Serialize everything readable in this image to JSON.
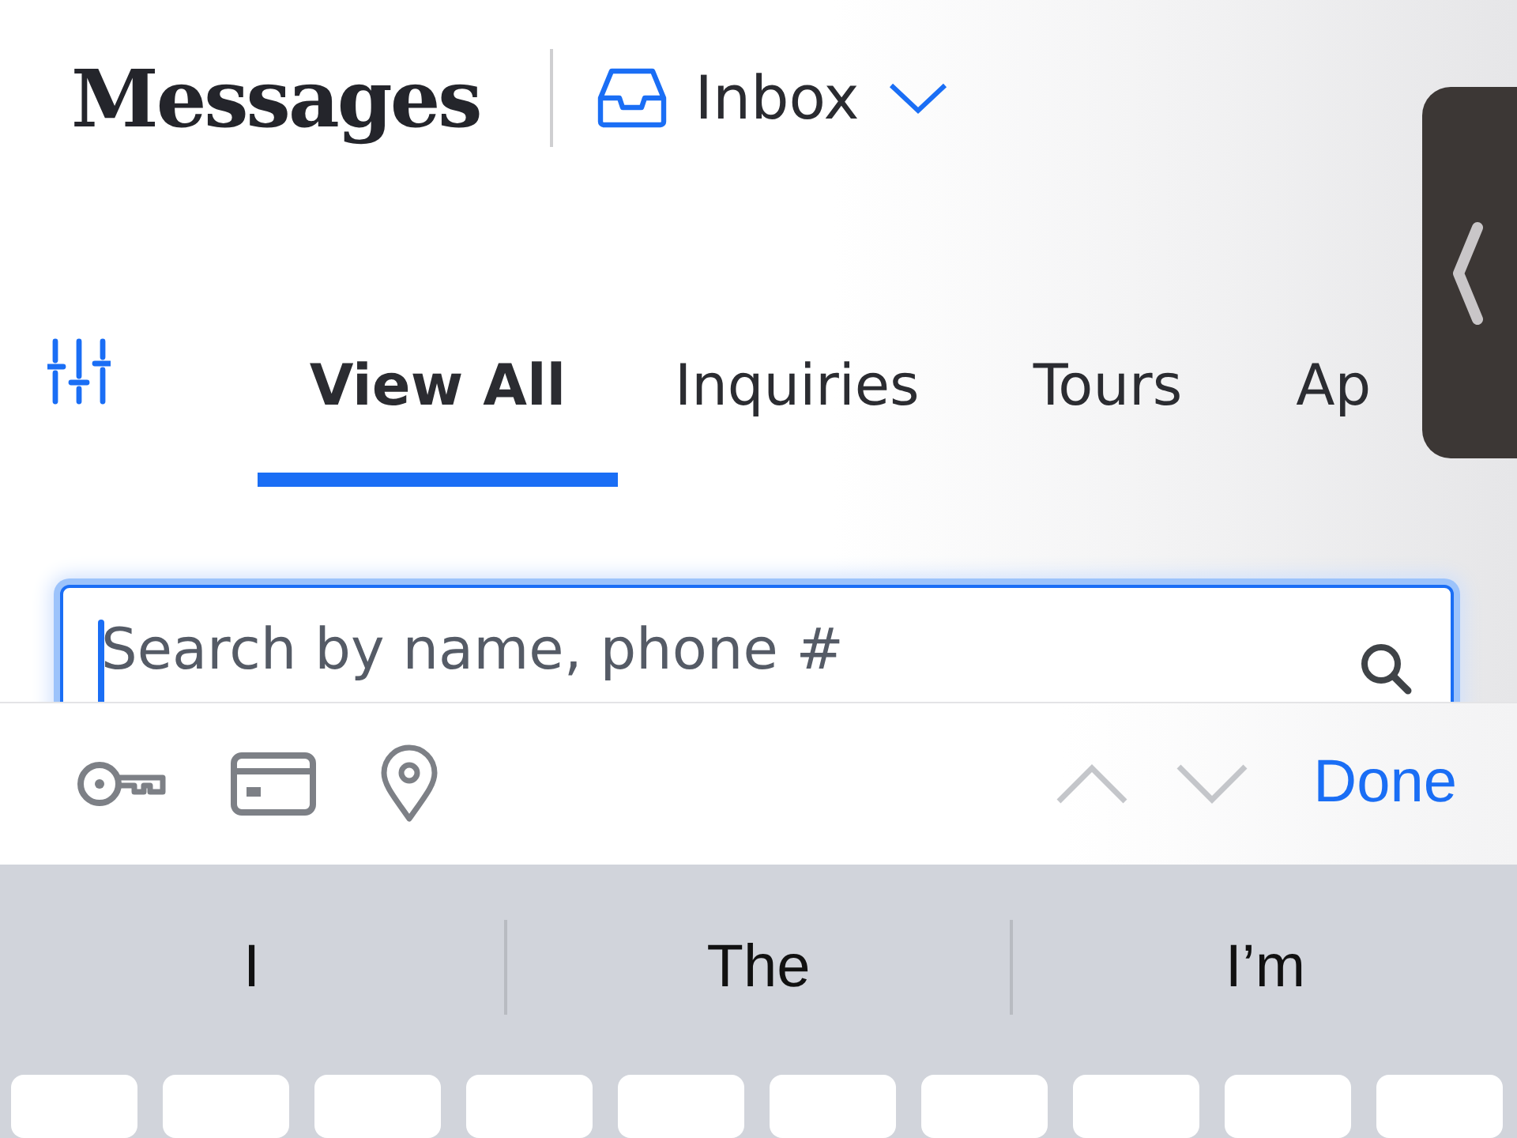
{
  "header": {
    "title": "Messages",
    "mailbox": "Inbox"
  },
  "tabs": [
    {
      "label": "View All",
      "selected": true
    },
    {
      "label": "Inquiries",
      "selected": false
    },
    {
      "label": "Tours",
      "selected": false
    },
    {
      "label": "Ap",
      "selected": false
    }
  ],
  "search": {
    "placeholder": "Search by name, phone #",
    "focused": true
  },
  "accessory_bar": {
    "previous_disabled": true,
    "next_disabled": true,
    "done": "Done"
  },
  "suggestions": [
    "I",
    "The",
    "I’m"
  ]
}
